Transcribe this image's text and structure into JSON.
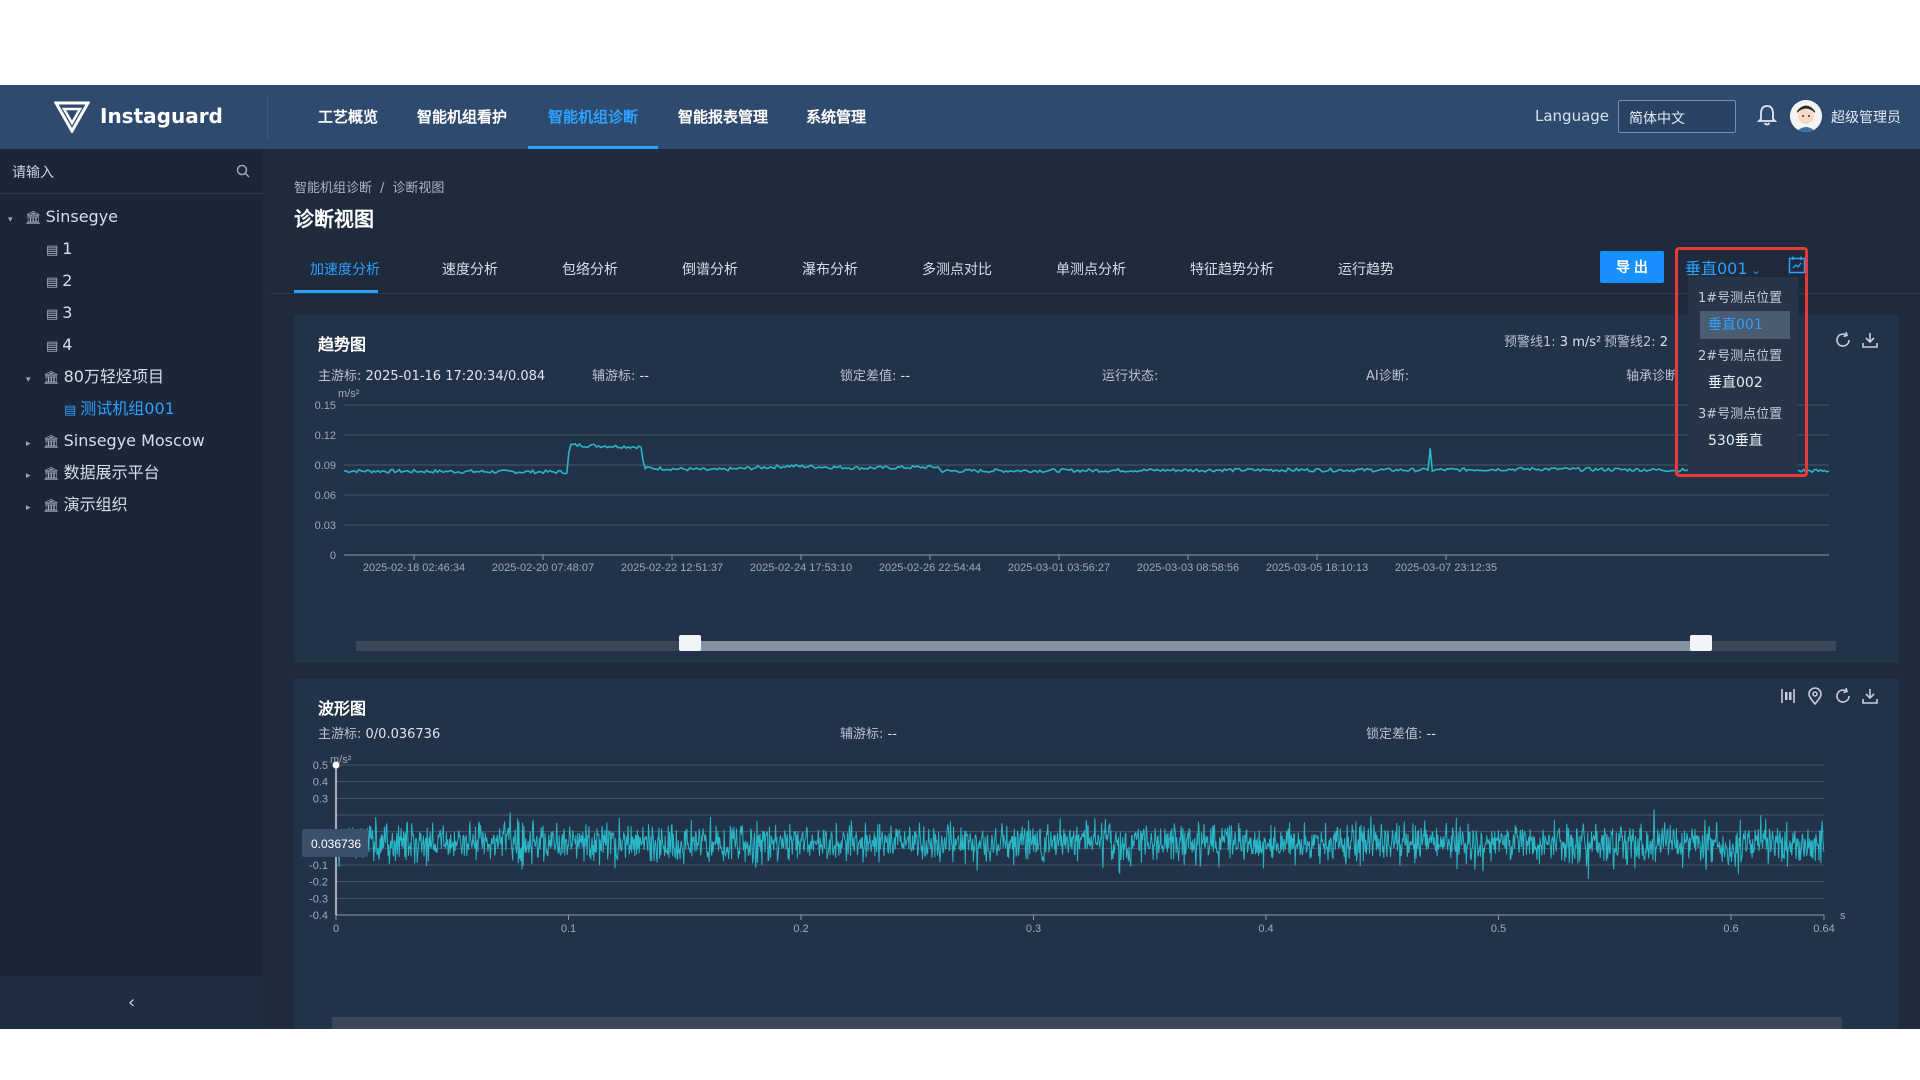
{
  "app": {
    "name": "Instaguard"
  },
  "nav": {
    "items": [
      "工艺概览",
      "智能机组看护",
      "智能机组诊断",
      "智能报表管理",
      "系统管理"
    ],
    "active_index": 2,
    "language_label": "Language",
    "language_value": "简体中文",
    "user_name": "超级管理员"
  },
  "sidebar": {
    "search_placeholder": "请输入",
    "tree": [
      "Sinsegye",
      "1",
      "2",
      "3",
      "4",
      "80万轻烃项目",
      "测试机组001",
      "Sinsegye Moscow",
      "数据展示平台",
      "演示组织"
    ],
    "selected": "测试机组001"
  },
  "breadcrumb": {
    "parent": "智能机组诊断",
    "sep": "/",
    "current": "诊断视图"
  },
  "page_title": "诊断视图",
  "tabs": [
    "加速度分析",
    "速度分析",
    "包络分析",
    "倒谱分析",
    "瀑布分析",
    "多测点对比",
    "单测点分析",
    "特征趋势分析",
    "运行趋势"
  ],
  "active_tab": 0,
  "toolbar": {
    "export_label": "导 出",
    "point_selected": "垂直001"
  },
  "dropdown": {
    "groups": [
      {
        "label": "1#号测点位置",
        "options": [
          "垂直001"
        ]
      },
      {
        "label": "2#号测点位置",
        "options": [
          "垂直002"
        ]
      },
      {
        "label": "3#号测点位置",
        "options": [
          "530垂直"
        ]
      }
    ],
    "active": "垂直001"
  },
  "trend": {
    "title": "趋势图",
    "warn1_label": "预警线1:",
    "warn1_value": "3 m/s²",
    "warn2_label": "预警线2:",
    "warn2_value": "2",
    "main_cursor_label": "主游标:",
    "main_cursor_value": "2025-01-16 17:20:34/0.084",
    "aux_cursor_label": "辅游标:",
    "aux_cursor_value": "--",
    "lock_diff_label": "锁定差值:",
    "lock_diff_value": "--",
    "run_state_label": "运行状态:",
    "ai_label": "AI诊断:",
    "bearing_label": "轴承诊断"
  },
  "wave": {
    "title": "波形图",
    "main_cursor_label": "主游标:",
    "main_cursor_value": "0/0.036736",
    "aux_cursor_label": "辅游标:",
    "aux_cursor_value": "--",
    "lock_diff_label": "锁定差值:",
    "lock_diff_value": "--",
    "tooltip": "0.036736"
  },
  "chart_data": [
    {
      "type": "line",
      "title": "趋势图",
      "ylabel": "m/s²",
      "ylim": [
        0,
        0.15
      ],
      "yticks": [
        "0.15",
        "0.12",
        "0.09",
        "0.06",
        "0.03",
        "0"
      ],
      "xticks": [
        "2025-02-18 02:46:34",
        "2025-02-20 07:48:07",
        "2025-02-22 12:51:37",
        "2025-02-24 17:53:10",
        "2025-02-26 22:54:44",
        "2025-03-01 03:56:27",
        "2025-03-03 08:58:56",
        "2025-03-05 18:10:13",
        "2025-03-07 23:12:35"
      ],
      "x": [
        0,
        0.15,
        0.152,
        0.2,
        0.202,
        0.25,
        0.3,
        0.35,
        0.4,
        0.402,
        0.6,
        0.73,
        0.731,
        0.732,
        0.8,
        1.0
      ],
      "values": [
        0.084,
        0.083,
        0.11,
        0.108,
        0.087,
        0.085,
        0.089,
        0.087,
        0.088,
        0.084,
        0.085,
        0.085,
        0.123,
        0.085,
        0.086,
        0.084
      ],
      "grid": true
    },
    {
      "type": "line",
      "title": "波形图",
      "ylabel": "m/s²",
      "xlabel": "s",
      "ylim": [
        -0.4,
        0.5
      ],
      "yticks": [
        "0.5",
        "0.4",
        "0.3",
        "",
        "",
        "0",
        "-0.1",
        "-0.2",
        "-0.3",
        "-0.4"
      ],
      "xticks": [
        "0",
        "0.1",
        "0.2",
        "0.3",
        "0.4",
        "0.5",
        "0.6",
        "0.64"
      ],
      "xlim": [
        0,
        0.64
      ],
      "cursor": {
        "x": 0,
        "y": 0.036736
      },
      "grid": true
    }
  ],
  "colors": {
    "series": "#29b6c5",
    "accent": "#2ea0ff",
    "nav_bg": "#2e4a6e",
    "frame": "#e83a3a"
  }
}
